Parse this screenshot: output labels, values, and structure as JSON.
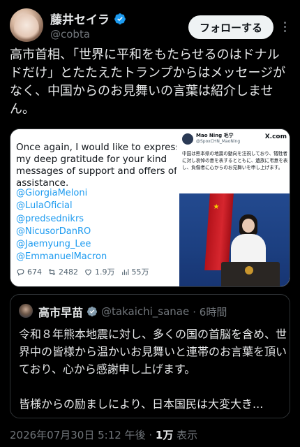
{
  "author": {
    "display_name": "藤井セイラ",
    "handle": "@cobta",
    "follow_label": "フォローする"
  },
  "tweet": {
    "text": "高市首相、「世界に平和をもたらせるのはドナルドだけ」とたたえたトランプからはメッセージがなく、中国からのお見舞いの言葉は紹介しません。"
  },
  "media": {
    "left": {
      "text": "Once again, I would like to express my deep gratitude for your kind messages of support and offers of assistance.",
      "mentions": [
        "@GiorgiaMeloni",
        "@LulaOficial",
        "@predsednikrs",
        "@NicusorDanRO",
        "@Jaemyung_Lee",
        "@EmmanuelMacron"
      ],
      "stats": {
        "replies": "674",
        "retweets": "2482",
        "likes": "1.9万",
        "views": "55万"
      }
    },
    "right": {
      "name": "Mao Ning 毛宁",
      "handle": "@SpoxCHN_MaoNing",
      "site": "X.com",
      "text": "中国は熊本県の地震の動向を注視しており、犠牲者に対し哀悼の意を表するとともに、遺族に弔意を表し、負傷者に心からのお見舞いを申し上げます。"
    }
  },
  "quote": {
    "name": "高市早苗",
    "handle": "@takaichi_sanae",
    "time": "· 6時間",
    "paragraph1": "令和８年熊本地震に対し、多くの国の首脳を含め、世界中の皆様から温かいお見舞いと連帯のお言葉を頂いており、心から感謝申し上げます。",
    "paragraph2": "皆様からの励ましにより、日本国民は大変大き..."
  },
  "footer": {
    "timestamp": "2026年07月30日 5:12 午後",
    "separator": " · ",
    "views_count": "1万",
    "views_label": " 表示"
  },
  "colors": {
    "background": "#000000",
    "verified": "#1d9bf0",
    "text": "#e7e9ea",
    "muted": "#71767b"
  }
}
